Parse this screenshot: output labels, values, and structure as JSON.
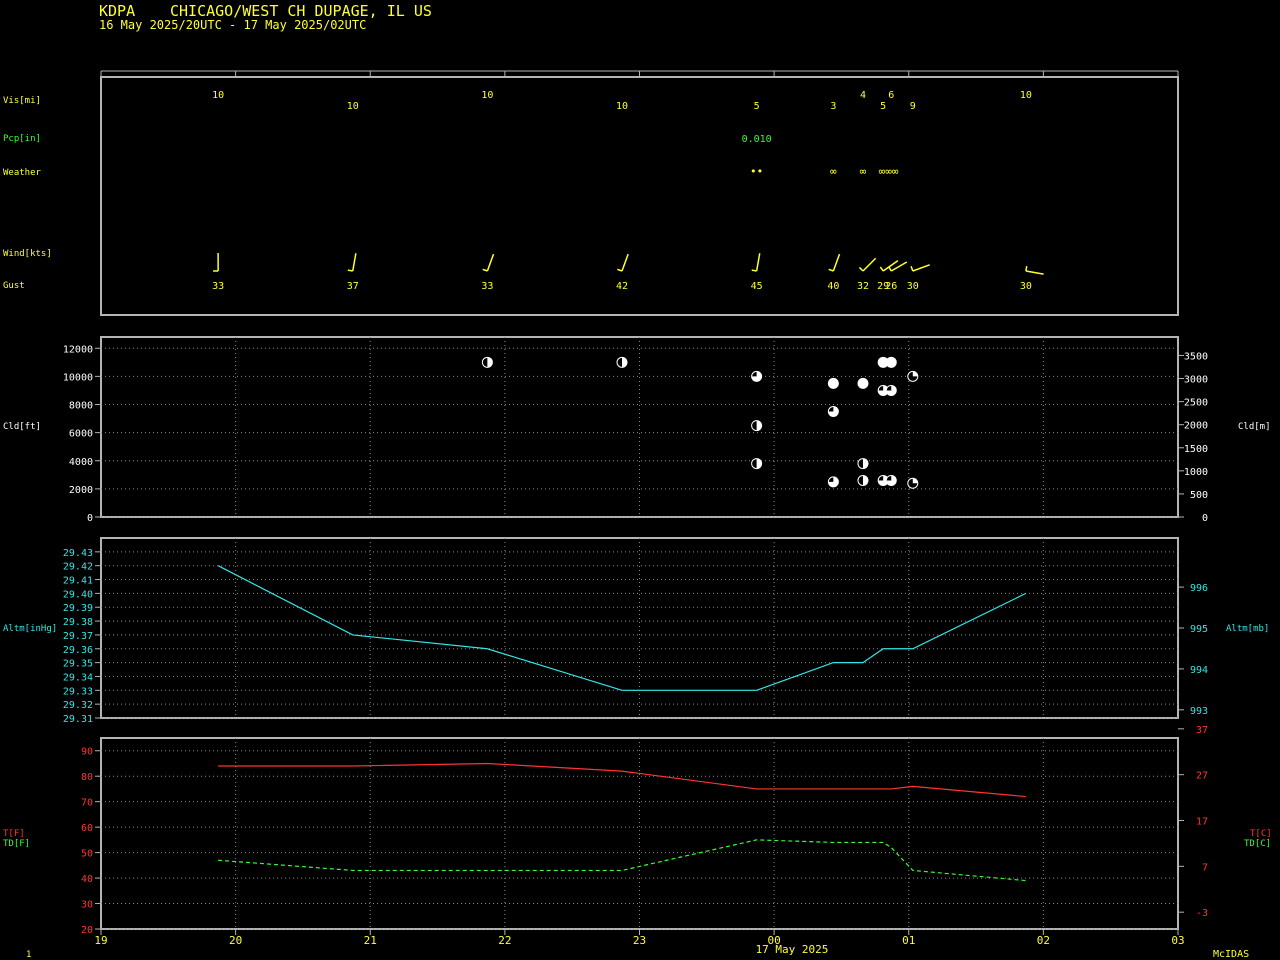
{
  "header": {
    "station": "KDPA",
    "location": "CHICAGO/WEST CH DUPAGE, IL US",
    "period": "16 May 2025/20UTC - 17 May 2025/02UTC"
  },
  "footer": {
    "page_number": "1",
    "date_label": "17 May 2025",
    "brand": "McIDAS"
  },
  "colors": {
    "yellow": "#ffff33",
    "green": "#33ff33",
    "cyan": "#33e6e6",
    "red": "#ff3333",
    "white": "#ffffff",
    "frame": "#b4b4b4"
  },
  "time_axis": {
    "range_hours": [
      19,
      27
    ],
    "ticks": [
      19,
      20,
      21,
      22,
      23,
      24,
      25,
      26,
      27
    ],
    "tick_labels": [
      "19",
      "20",
      "21",
      "22",
      "23",
      "00",
      "01",
      "02",
      "03"
    ]
  },
  "panels": {
    "obs": {
      "labels": {
        "vis": "Vis[mi]",
        "pcp": "Pcp[in]",
        "weather": "Weather",
        "wind": "Wind[kts]",
        "gust": "Gust"
      }
    },
    "cloud": {
      "left_label": "Cld[ft]",
      "right_label": "Cld[m]",
      "left_ticks": [
        "0",
        "2000",
        "4000",
        "6000",
        "8000",
        "10000",
        "12000"
      ],
      "right_ticks": [
        "0",
        "500",
        "1000",
        "1500",
        "2000",
        "2500",
        "3000",
        "3500"
      ]
    },
    "altimeter": {
      "left_label": "Altm[inHg]",
      "right_label": "Altm[mb]",
      "left_ticks": [
        "29.31",
        "29.32",
        "29.33",
        "29.34",
        "29.35",
        "29.36",
        "29.37",
        "29.38",
        "29.39",
        "29.40",
        "29.41",
        "29.42",
        "29.43"
      ],
      "right_ticks": [
        "993",
        "994",
        "995",
        "996"
      ]
    },
    "temp": {
      "left_label_t": "T[F]",
      "left_label_td": "TD[F]",
      "right_label_t": "T[C]",
      "right_label_td": "TD[C]",
      "left_ticks": [
        "20",
        "30",
        "40",
        "50",
        "60",
        "70",
        "80",
        "90"
      ],
      "right_ticks": [
        "-3",
        "7",
        "17",
        "27",
        "37"
      ]
    }
  },
  "chart_data": [
    {
      "type": "table",
      "name": "surface observations",
      "visibility_mi": [
        {
          "x": 19.87,
          "v": "10"
        },
        {
          "x": 20.87,
          "v": "10"
        },
        {
          "x": 21.87,
          "v": "10"
        },
        {
          "x": 22.87,
          "v": "10"
        },
        {
          "x": 23.87,
          "v": "5"
        },
        {
          "x": 24.44,
          "v": "3"
        },
        {
          "x": 24.66,
          "v": "4"
        },
        {
          "x": 24.81,
          "v": "5"
        },
        {
          "x": 24.87,
          "v": "6"
        },
        {
          "x": 25.03,
          "v": "9"
        },
        {
          "x": 25.87,
          "v": "10"
        }
      ],
      "precip_in": [
        {
          "x": 23.87,
          "v": "0.010"
        }
      ],
      "weather": [
        {
          "x": 23.87,
          "symbol": "••"
        },
        {
          "x": 24.44,
          "symbol": "∞"
        },
        {
          "x": 24.66,
          "symbol": "∞"
        },
        {
          "x": 24.85,
          "symbol": "∞∞∞"
        }
      ],
      "gust_kts": [
        {
          "x": 19.87,
          "v": "33"
        },
        {
          "x": 20.87,
          "v": "37"
        },
        {
          "x": 21.87,
          "v": "33"
        },
        {
          "x": 22.87,
          "v": "42"
        },
        {
          "x": 23.87,
          "v": "45"
        },
        {
          "x": 24.44,
          "v": "40"
        },
        {
          "x": 24.66,
          "v": "32"
        },
        {
          "x": 24.81,
          "v": "29"
        },
        {
          "x": 24.87,
          "v": "26"
        },
        {
          "x": 25.03,
          "v": "30"
        },
        {
          "x": 25.87,
          "v": "30"
        }
      ],
      "wind_barbs": [
        {
          "x": 19.87,
          "dir": 180
        },
        {
          "x": 20.87,
          "dir": 190
        },
        {
          "x": 21.87,
          "dir": 200
        },
        {
          "x": 22.87,
          "dir": 200
        },
        {
          "x": 23.87,
          "dir": 190
        },
        {
          "x": 24.44,
          "dir": 200
        },
        {
          "x": 24.66,
          "dir": 225
        },
        {
          "x": 24.81,
          "dir": 235
        },
        {
          "x": 24.87,
          "dir": 240
        },
        {
          "x": 25.03,
          "dir": 250
        },
        {
          "x": 25.87,
          "dir": 280
        }
      ]
    },
    {
      "type": "scatter",
      "name": "cloud layers",
      "ylim_ft": [
        0,
        12800
      ],
      "ylim_m": [
        0,
        3900
      ],
      "layers": [
        {
          "x": 21.87,
          "ft": 11000,
          "cover": "SCT"
        },
        {
          "x": 22.87,
          "ft": 11000,
          "cover": "SCT"
        },
        {
          "x": 23.87,
          "ft": 3800,
          "cover": "SCT"
        },
        {
          "x": 23.87,
          "ft": 6500,
          "cover": "SCT"
        },
        {
          "x": 23.87,
          "ft": 10000,
          "cover": "BKN"
        },
        {
          "x": 24.44,
          "ft": 2500,
          "cover": "BKN"
        },
        {
          "x": 24.44,
          "ft": 7500,
          "cover": "BKN"
        },
        {
          "x": 24.44,
          "ft": 9500,
          "cover": "OVC"
        },
        {
          "x": 24.66,
          "ft": 2600,
          "cover": "SCT"
        },
        {
          "x": 24.66,
          "ft": 3800,
          "cover": "SCT"
        },
        {
          "x": 24.66,
          "ft": 9500,
          "cover": "OVC"
        },
        {
          "x": 24.81,
          "ft": 2600,
          "cover": "BKN"
        },
        {
          "x": 24.81,
          "ft": 9000,
          "cover": "BKN"
        },
        {
          "x": 24.81,
          "ft": 11000,
          "cover": "OVC"
        },
        {
          "x": 24.87,
          "ft": 2600,
          "cover": "BKN"
        },
        {
          "x": 24.87,
          "ft": 9000,
          "cover": "BKN"
        },
        {
          "x": 24.87,
          "ft": 11000,
          "cover": "OVC"
        },
        {
          "x": 25.03,
          "ft": 2400,
          "cover": "FEW"
        },
        {
          "x": 25.03,
          "ft": 10000,
          "cover": "FEW"
        }
      ]
    },
    {
      "type": "line",
      "name": "altimeter",
      "ylim": [
        29.31,
        29.44
      ],
      "x": [
        19.87,
        20.87,
        21.87,
        22.87,
        23.87,
        24.44,
        24.66,
        24.81,
        25.03,
        25.87
      ],
      "series": [
        {
          "values": [
            29.42,
            29.37,
            29.36,
            29.33,
            29.33,
            29.35,
            29.35,
            29.36,
            29.36,
            29.4
          ]
        }
      ]
    },
    {
      "type": "line",
      "name": "temperature",
      "ylim": [
        20,
        95
      ],
      "x": [
        19.87,
        20.87,
        21.87,
        22.87,
        23.87,
        24.44,
        24.66,
        24.81,
        24.87,
        25.03,
        25.87
      ],
      "series": [
        {
          "values": [
            84,
            84,
            85,
            82,
            75,
            75,
            75,
            75,
            75,
            76,
            72
          ]
        },
        {
          "values": [
            47,
            43,
            43,
            43,
            55,
            54,
            54,
            54,
            52,
            43,
            39
          ]
        }
      ]
    }
  ]
}
